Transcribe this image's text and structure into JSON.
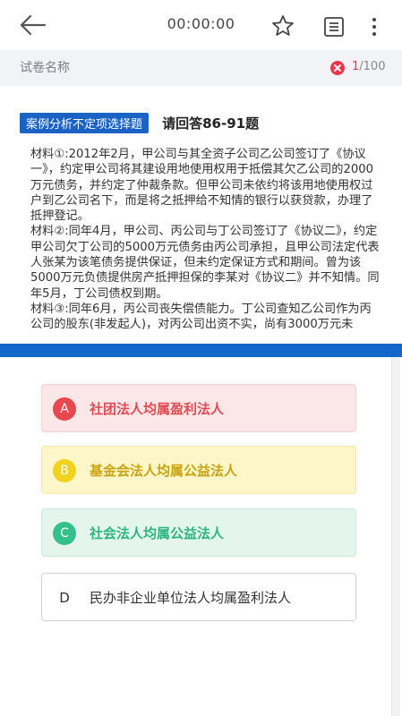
{
  "header": {
    "timer": "00:00:00",
    "icons": [
      "back-arrow-icon",
      "star-icon",
      "answer-sheet-icon",
      "more-vertical-icon"
    ]
  },
  "subbar": {
    "paper_name": "试卷名称",
    "progress_current": "1",
    "progress_total": "/100",
    "status_icon": "wrong-icon",
    "status_color": "#e8364b"
  },
  "question": {
    "type_label": "案例分析不定项选择题",
    "range_label": "请回答86-91题",
    "material_lines": [
      "材料①:2012年2月，甲公司与其全资子公司乙公司签订了《协议一》，约定甲公司将其建设用地使用权用于抵偿其欠乙公司的2000万元债务，并约定了仲裁条款。但甲公司未依约将该用地使用权过户到乙公司名下，而是将之抵押给不知情的银行以获贷款，办理了抵押登记。",
      "材料②:同年4月，甲公司、丙公司与丁公司签订了《协议二》，约定甲公司欠丁公司的5000万元债务由丙公司承担，且甲公司法定代表人张某为该笔债务提供保证，但未约定保证方式和期间。曾为该5000万元负债提供房产抵押担保的李某对《协议二》并不知情。同年5月，丁公司债权到期。",
      "材料③:同年6月，丙公司丧失偿债能力。丁公司查知乙公司作为丙公司的股东(非发起人)，对丙公司出资不实，尚有3000万元未"
    ]
  },
  "options": [
    {
      "letter": "A",
      "text": "社团法人均属盈利法人",
      "state": "wrong",
      "color": "#e8474e"
    },
    {
      "letter": "B",
      "text": "基金会法人均属公益法人",
      "state": "neutral",
      "color": "#f3d21f"
    },
    {
      "letter": "C",
      "text": "社会法人均属公益法人",
      "state": "correct",
      "color": "#33c08a"
    },
    {
      "letter": "D",
      "text": "民办非企业单位法人均属盈利法人",
      "state": "plain",
      "color": "#333333"
    }
  ],
  "colors": {
    "accent": "#1467c8",
    "type_badge": "#1a63c4"
  }
}
